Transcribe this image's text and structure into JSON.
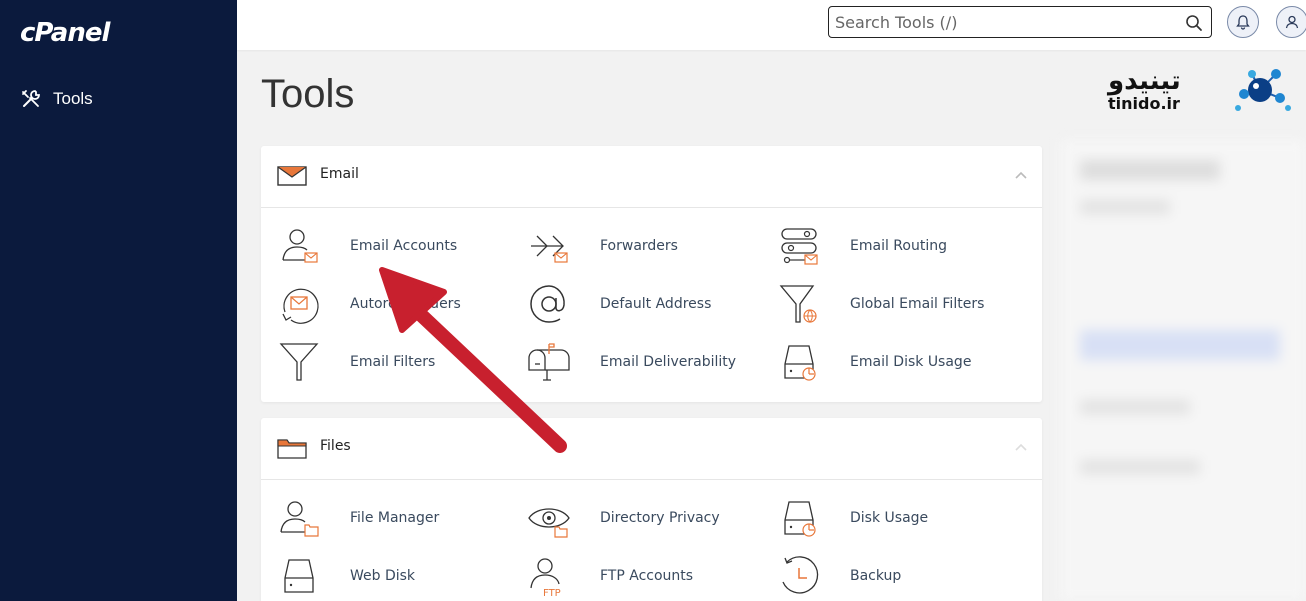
{
  "sidebar": {
    "logo": "cPanel",
    "items": [
      {
        "label": "Tools",
        "icon": "tools-icon"
      }
    ]
  },
  "header": {
    "search": {
      "placeholder": "Search Tools (/)",
      "value": ""
    },
    "notifications_icon": "bell-icon",
    "user_icon": "user-icon"
  },
  "page": {
    "title": "Tools"
  },
  "watermark": {
    "fa_text": "تینیدو",
    "en_text": "tinido.ir"
  },
  "sections": [
    {
      "title": "Email",
      "icon": "envelope-icon",
      "collapsed": false,
      "tools": [
        {
          "label": "Email Accounts",
          "icon": "email-accounts-icon"
        },
        {
          "label": "Forwarders",
          "icon": "forwarders-icon"
        },
        {
          "label": "Email Routing",
          "icon": "email-routing-icon"
        },
        {
          "label": "Autoresponders",
          "icon": "autoresponders-icon"
        },
        {
          "label": "Default Address",
          "icon": "at-sign-icon"
        },
        {
          "label": "Global Email Filters",
          "icon": "global-filter-icon"
        },
        {
          "label": "Email Filters",
          "icon": "filter-icon"
        },
        {
          "label": "Email Deliverability",
          "icon": "mailbox-icon"
        },
        {
          "label": "Email Disk Usage",
          "icon": "disk-usage-icon"
        }
      ]
    },
    {
      "title": "Files",
      "icon": "folder-icon",
      "collapsed": false,
      "tools": [
        {
          "label": "File Manager",
          "icon": "file-manager-icon"
        },
        {
          "label": "Directory Privacy",
          "icon": "eye-icon"
        },
        {
          "label": "Disk Usage",
          "icon": "disk-usage-icon"
        },
        {
          "label": "Web Disk",
          "icon": "web-disk-icon"
        },
        {
          "label": "FTP Accounts",
          "icon": "ftp-accounts-icon"
        },
        {
          "label": "Backup",
          "icon": "backup-icon"
        }
      ]
    }
  ],
  "colors": {
    "sidebar_bg": "#0b1a3d",
    "accent": "#e8773a",
    "arrow": "#c8202e",
    "text": "#3a4a5e"
  }
}
